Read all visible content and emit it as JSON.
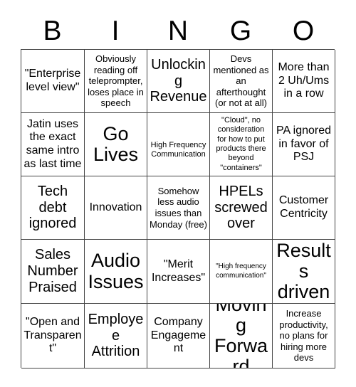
{
  "card": {
    "title_letters": [
      "B",
      "I",
      "N",
      "G",
      "O"
    ],
    "grid": {
      "rows": 5,
      "columns": 5,
      "border_color": "#444444",
      "background_color": "#ffffff",
      "text_color": "#000000"
    },
    "cells": [
      [
        {
          "text": "\"Enterprise level view\"",
          "size": "md"
        },
        {
          "text": "Obviously reading off teleprompter, loses place in speech",
          "size": "sm"
        },
        {
          "text": "Unlocking Revenue",
          "size": "lg"
        },
        {
          "text": "Devs mentioned as an afterthought (or not at all)",
          "size": "sm"
        },
        {
          "text": "More than 2 Uh/Ums in a row",
          "size": "md"
        }
      ],
      [
        {
          "text": "Jatin uses the exact same intro as last time",
          "size": "md"
        },
        {
          "text": "Go Lives",
          "size": "xl"
        },
        {
          "text": "High Frequency Communication",
          "size": "xs",
          "nudge": "down"
        },
        {
          "text": "\"Cloud\", no consideration for how to put products there beyond \"containers\"",
          "size": "xs"
        },
        {
          "text": "PA ignored in favor of PSJ",
          "size": "md"
        }
      ],
      [
        {
          "text": "Tech debt ignored",
          "size": "lg"
        },
        {
          "text": "Innovation",
          "size": "md"
        },
        {
          "text": "Somehow less audio issues than Monday (free)",
          "size": "sm"
        },
        {
          "text": "HPELs screwed over",
          "size": "lg"
        },
        {
          "text": "Customer Centricity",
          "size": "md"
        }
      ],
      [
        {
          "text": "Sales Number Praised",
          "size": "lg"
        },
        {
          "text": "Audio Issues",
          "size": "xl"
        },
        {
          "text": "\"Merit Increases\"",
          "size": "md"
        },
        {
          "text": "\"High frequency communication\"",
          "size": "xxs"
        },
        {
          "text": "Results driven",
          "size": "xl"
        }
      ],
      [
        {
          "text": "\"Open and Transparent\"",
          "size": "md"
        },
        {
          "text": "Employee Attrition",
          "size": "lg"
        },
        {
          "text": "Company Engagement",
          "size": "md"
        },
        {
          "text": "Moving Forward",
          "size": "xl"
        },
        {
          "text": "Increase productivity, no plans for hiring more devs",
          "size": "sm"
        }
      ]
    ]
  }
}
